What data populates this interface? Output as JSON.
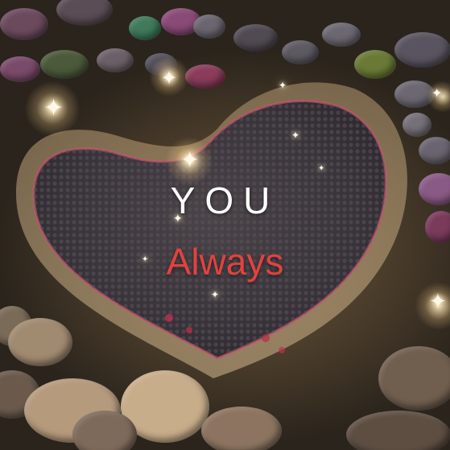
{
  "text": {
    "headline": "YOU",
    "subline": "Always"
  },
  "colors": {
    "headline": "#ffffff",
    "subline": "#e0433f",
    "heart_fill": "#3a3538",
    "heart_rim": "#c8566e",
    "sand": "#6e5a3e"
  }
}
